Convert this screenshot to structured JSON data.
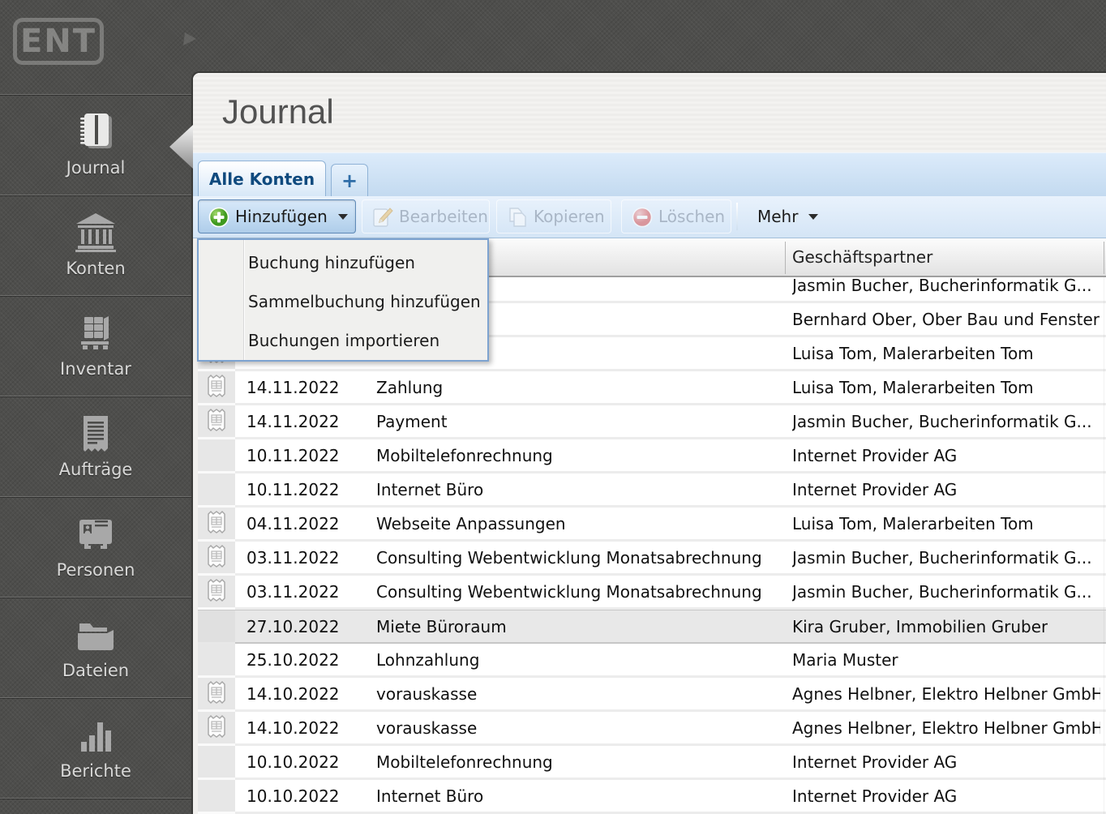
{
  "branding": {
    "logo_text": "ENT",
    "logo_icon": "eagle-emblem-icon"
  },
  "sidebar": {
    "items": [
      {
        "name": "sidebar-item-journal",
        "label": "Journal",
        "icon": "journal-notebook-icon",
        "active": true
      },
      {
        "name": "sidebar-item-konten",
        "label": "Konten",
        "icon": "bank-icon",
        "active": false
      },
      {
        "name": "sidebar-item-inventar",
        "label": "Inventar",
        "icon": "pallet-icon",
        "active": false
      },
      {
        "name": "sidebar-item-auftraege",
        "label": "Aufträge",
        "icon": "order-receipt-icon",
        "active": false
      },
      {
        "name": "sidebar-item-personen",
        "label": "Personen",
        "icon": "contact-card-icon",
        "active": false
      },
      {
        "name": "sidebar-item-dateien",
        "label": "Dateien",
        "icon": "folder-icon",
        "active": false
      },
      {
        "name": "sidebar-item-berichte",
        "label": "Berichte",
        "icon": "bar-chart-icon",
        "active": false
      }
    ]
  },
  "panel": {
    "title": "Journal",
    "tabs": [
      {
        "name": "tab-alle-konten",
        "label": "Alle Konten",
        "active": true,
        "type": "tab"
      },
      {
        "name": "tab-new",
        "label": "+",
        "active": false,
        "type": "new-tab"
      }
    ],
    "toolbar": {
      "buttons": [
        {
          "name": "add-button",
          "label": "Hinzufügen",
          "icon": "add-icon",
          "enabled": true,
          "menu_open": true,
          "has_caret": true
        },
        {
          "name": "edit-button",
          "label": "Bearbeiten",
          "icon": "edit-pencil-icon",
          "enabled": false,
          "menu_open": false,
          "has_caret": false
        },
        {
          "name": "copy-button",
          "label": "Kopieren",
          "icon": "copy-icon",
          "enabled": false,
          "menu_open": false,
          "has_caret": false
        },
        {
          "name": "delete-button",
          "label": "Löschen",
          "icon": "delete-icon",
          "enabled": false,
          "menu_open": false,
          "has_caret": false
        },
        {
          "name": "more-button",
          "label": "Mehr",
          "icon": null,
          "enabled": true,
          "menu_open": false,
          "has_caret": true
        }
      ]
    },
    "add_menu": {
      "items": [
        {
          "name": "menu-item-buchung-hinzufuegen",
          "label": "Buchung hinzufügen"
        },
        {
          "name": "menu-item-sammelbuchung-hinzufuegen",
          "label": "Sammelbuchung hinzufügen"
        },
        {
          "name": "menu-item-buchungen-importieren",
          "label": "Buchungen importieren"
        }
      ]
    },
    "table": {
      "visible_headers": {
        "partner": "Geschäftspartner"
      },
      "rows": [
        {
          "date": "",
          "description": "",
          "partner": "Jasmin Bucher, Bucherinformatik G...",
          "has_receipt_icon": false,
          "selected": false
        },
        {
          "date": "",
          "description": "",
          "partner": "Bernhard Ober, Ober Bau und Fenster",
          "has_receipt_icon": false,
          "selected": false
        },
        {
          "date": "",
          "description": "",
          "partner": "Luisa Tom, Malerarbeiten Tom",
          "has_receipt_icon": true,
          "selected": false
        },
        {
          "date": "14.11.2022",
          "description": "Zahlung",
          "partner": "Luisa Tom, Malerarbeiten Tom",
          "has_receipt_icon": true,
          "selected": false
        },
        {
          "date": "14.11.2022",
          "description": "Payment",
          "partner": "Jasmin Bucher, Bucherinformatik G...",
          "has_receipt_icon": true,
          "selected": false
        },
        {
          "date": "10.11.2022",
          "description": "Mobiltelefonrechnung",
          "partner": "Internet Provider AG",
          "has_receipt_icon": false,
          "selected": false
        },
        {
          "date": "10.11.2022",
          "description": "Internet Büro",
          "partner": "Internet Provider AG",
          "has_receipt_icon": false,
          "selected": false
        },
        {
          "date": "04.11.2022",
          "description": "Webseite Anpassungen",
          "partner": "Luisa Tom, Malerarbeiten Tom",
          "has_receipt_icon": true,
          "selected": false
        },
        {
          "date": "03.11.2022",
          "description": "Consulting Webentwicklung Monatsabrechnung",
          "partner": "Jasmin Bucher, Bucherinformatik G...",
          "has_receipt_icon": true,
          "selected": false
        },
        {
          "date": "03.11.2022",
          "description": "Consulting Webentwicklung Monatsabrechnung",
          "partner": "Jasmin Bucher, Bucherinformatik G...",
          "has_receipt_icon": true,
          "selected": false
        },
        {
          "date": "27.10.2022",
          "description": "Miete Büroraum",
          "partner": "Kira Gruber, Immobilien Gruber",
          "has_receipt_icon": false,
          "selected": true
        },
        {
          "date": "25.10.2022",
          "description": "Lohnzahlung",
          "partner": "Maria Muster",
          "has_receipt_icon": false,
          "selected": false
        },
        {
          "date": "14.10.2022",
          "description": "vorauskasse",
          "partner": "Agnes Helbner, Elektro Helbner GmbH",
          "has_receipt_icon": true,
          "selected": false
        },
        {
          "date": "14.10.2022",
          "description": "vorauskasse",
          "partner": "Agnes Helbner, Elektro Helbner GmbH",
          "has_receipt_icon": true,
          "selected": false
        },
        {
          "date": "10.10.2022",
          "description": "Mobiltelefonrechnung",
          "partner": "Internet Provider AG",
          "has_receipt_icon": false,
          "selected": false
        },
        {
          "date": "10.10.2022",
          "description": "Internet Büro",
          "partner": "Internet Provider AG",
          "has_receipt_icon": false,
          "selected": false
        }
      ]
    }
  },
  "colors": {
    "sidebar_bg": "#4e4e4c",
    "toolbar_blue": "#d4e5f6",
    "active_tab_text": "#0f4a7e",
    "selected_row_bg": "#e8e8e8",
    "accent_border_blue": "#7da3d0",
    "add_icon_green": "#4e9e2e",
    "delete_icon_red": "#d85454"
  }
}
